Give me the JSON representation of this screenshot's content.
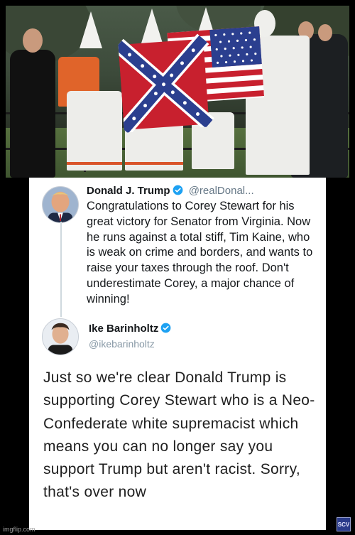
{
  "tweet_primary": {
    "display_name": "Donald J. Trump",
    "handle": "@realDonal...",
    "verified": true,
    "text": "Congratulations to Corey Stewart for his great victory for Senator from Virginia. Now he runs against a total stiff, Tim Kaine, who is weak on crime and borders, and wants to raise your taxes through the roof. Don't underestimate Corey, a major chance of winning!"
  },
  "tweet_reply": {
    "display_name": "Ike Barinholtz",
    "handle": "@ikebarinholtz",
    "verified": true,
    "text": "Just so we're clear Donald Trump is supporting Corey Stewart who is a Neo-Confederate white supremacist which means you can no longer say you support Trump but aren't racist. Sorry, that's over now"
  },
  "watermark": {
    "site": "imgflip.com",
    "badge": "SCV"
  },
  "colors": {
    "verified_blue": "#1da1f2",
    "text_primary": "#14171a",
    "text_secondary": "#657786",
    "flag_red": "#c8202e",
    "flag_blue": "#2b3f8f"
  }
}
